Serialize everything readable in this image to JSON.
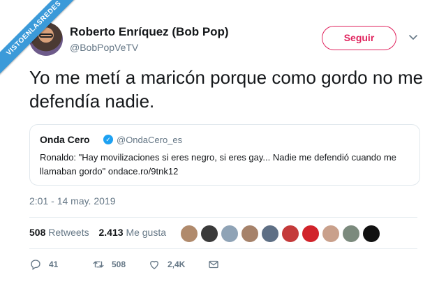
{
  "watermark": {
    "text": "VISTOENLASREDES"
  },
  "author": {
    "name": "Roberto Enríquez (Bob Pop)",
    "handle": "@BobPopVeTV"
  },
  "follow_button": {
    "label": "Seguir",
    "color": "#e0245e"
  },
  "tweet": {
    "text": "Yo me metí a maricón porque como gordo no me defendía nadie.",
    "timestamp": "2:01 - 14 may. 2019"
  },
  "quoted": {
    "name": "Onda Cero",
    "verified": true,
    "handle": "@OndaCero_es",
    "text": "Ronaldo: \"Hay movilizaciones si eres negro, si eres gay... Nadie me defendió cuando me llamaban gordo\" ondace.ro/9tnk12"
  },
  "stats": {
    "retweets_count": "508",
    "retweets_label": "Retweets",
    "likes_count": "2.413",
    "likes_label": "Me gusta"
  },
  "likers": [
    "#b08a6c",
    "#3a3a3a",
    "#8fa3b6",
    "#a6826a",
    "#5e6f85",
    "#c43a3a",
    "#d1232a",
    "#c9a08b",
    "#7b8a7d",
    "#111111"
  ],
  "actions": {
    "replies": "41",
    "retweets": "508",
    "likes": "2,4K"
  },
  "colors": {
    "text": "#14171a",
    "secondary": "#657786",
    "border": "#e1e8ed",
    "verified": "#1da1f2"
  }
}
